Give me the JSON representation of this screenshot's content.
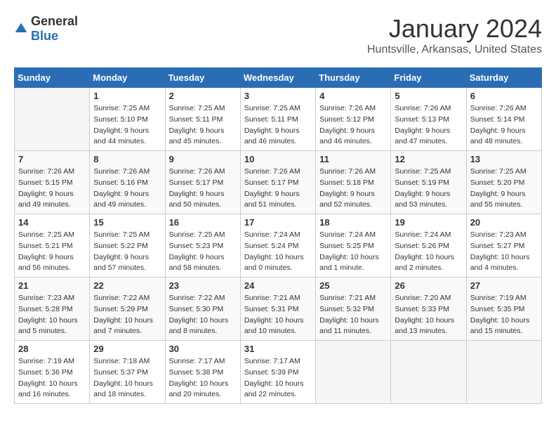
{
  "header": {
    "logo_general": "General",
    "logo_blue": "Blue",
    "title": "January 2024",
    "subtitle": "Huntsville, Arkansas, United States"
  },
  "days_of_week": [
    "Sunday",
    "Monday",
    "Tuesday",
    "Wednesday",
    "Thursday",
    "Friday",
    "Saturday"
  ],
  "weeks": [
    [
      {
        "day": "",
        "info": ""
      },
      {
        "day": "1",
        "info": "Sunrise: 7:25 AM\nSunset: 5:10 PM\nDaylight: 9 hours\nand 44 minutes."
      },
      {
        "day": "2",
        "info": "Sunrise: 7:25 AM\nSunset: 5:11 PM\nDaylight: 9 hours\nand 45 minutes."
      },
      {
        "day": "3",
        "info": "Sunrise: 7:25 AM\nSunset: 5:11 PM\nDaylight: 9 hours\nand 46 minutes."
      },
      {
        "day": "4",
        "info": "Sunrise: 7:26 AM\nSunset: 5:12 PM\nDaylight: 9 hours\nand 46 minutes."
      },
      {
        "day": "5",
        "info": "Sunrise: 7:26 AM\nSunset: 5:13 PM\nDaylight: 9 hours\nand 47 minutes."
      },
      {
        "day": "6",
        "info": "Sunrise: 7:26 AM\nSunset: 5:14 PM\nDaylight: 9 hours\nand 48 minutes."
      }
    ],
    [
      {
        "day": "7",
        "info": "Sunrise: 7:26 AM\nSunset: 5:15 PM\nDaylight: 9 hours\nand 49 minutes."
      },
      {
        "day": "8",
        "info": "Sunrise: 7:26 AM\nSunset: 5:16 PM\nDaylight: 9 hours\nand 49 minutes."
      },
      {
        "day": "9",
        "info": "Sunrise: 7:26 AM\nSunset: 5:17 PM\nDaylight: 9 hours\nand 50 minutes."
      },
      {
        "day": "10",
        "info": "Sunrise: 7:26 AM\nSunset: 5:17 PM\nDaylight: 9 hours\nand 51 minutes."
      },
      {
        "day": "11",
        "info": "Sunrise: 7:26 AM\nSunset: 5:18 PM\nDaylight: 9 hours\nand 52 minutes."
      },
      {
        "day": "12",
        "info": "Sunrise: 7:25 AM\nSunset: 5:19 PM\nDaylight: 9 hours\nand 53 minutes."
      },
      {
        "day": "13",
        "info": "Sunrise: 7:25 AM\nSunset: 5:20 PM\nDaylight: 9 hours\nand 55 minutes."
      }
    ],
    [
      {
        "day": "14",
        "info": "Sunrise: 7:25 AM\nSunset: 5:21 PM\nDaylight: 9 hours\nand 56 minutes."
      },
      {
        "day": "15",
        "info": "Sunrise: 7:25 AM\nSunset: 5:22 PM\nDaylight: 9 hours\nand 57 minutes."
      },
      {
        "day": "16",
        "info": "Sunrise: 7:25 AM\nSunset: 5:23 PM\nDaylight: 9 hours\nand 58 minutes."
      },
      {
        "day": "17",
        "info": "Sunrise: 7:24 AM\nSunset: 5:24 PM\nDaylight: 10 hours\nand 0 minutes."
      },
      {
        "day": "18",
        "info": "Sunrise: 7:24 AM\nSunset: 5:25 PM\nDaylight: 10 hours\nand 1 minute."
      },
      {
        "day": "19",
        "info": "Sunrise: 7:24 AM\nSunset: 5:26 PM\nDaylight: 10 hours\nand 2 minutes."
      },
      {
        "day": "20",
        "info": "Sunrise: 7:23 AM\nSunset: 5:27 PM\nDaylight: 10 hours\nand 4 minutes."
      }
    ],
    [
      {
        "day": "21",
        "info": "Sunrise: 7:23 AM\nSunset: 5:28 PM\nDaylight: 10 hours\nand 5 minutes."
      },
      {
        "day": "22",
        "info": "Sunrise: 7:22 AM\nSunset: 5:29 PM\nDaylight: 10 hours\nand 7 minutes."
      },
      {
        "day": "23",
        "info": "Sunrise: 7:22 AM\nSunset: 5:30 PM\nDaylight: 10 hours\nand 8 minutes."
      },
      {
        "day": "24",
        "info": "Sunrise: 7:21 AM\nSunset: 5:31 PM\nDaylight: 10 hours\nand 10 minutes."
      },
      {
        "day": "25",
        "info": "Sunrise: 7:21 AM\nSunset: 5:32 PM\nDaylight: 10 hours\nand 11 minutes."
      },
      {
        "day": "26",
        "info": "Sunrise: 7:20 AM\nSunset: 5:33 PM\nDaylight: 10 hours\nand 13 minutes."
      },
      {
        "day": "27",
        "info": "Sunrise: 7:19 AM\nSunset: 5:35 PM\nDaylight: 10 hours\nand 15 minutes."
      }
    ],
    [
      {
        "day": "28",
        "info": "Sunrise: 7:19 AM\nSunset: 5:36 PM\nDaylight: 10 hours\nand 16 minutes."
      },
      {
        "day": "29",
        "info": "Sunrise: 7:18 AM\nSunset: 5:37 PM\nDaylight: 10 hours\nand 18 minutes."
      },
      {
        "day": "30",
        "info": "Sunrise: 7:17 AM\nSunset: 5:38 PM\nDaylight: 10 hours\nand 20 minutes."
      },
      {
        "day": "31",
        "info": "Sunrise: 7:17 AM\nSunset: 5:39 PM\nDaylight: 10 hours\nand 22 minutes."
      },
      {
        "day": "",
        "info": ""
      },
      {
        "day": "",
        "info": ""
      },
      {
        "day": "",
        "info": ""
      }
    ]
  ]
}
